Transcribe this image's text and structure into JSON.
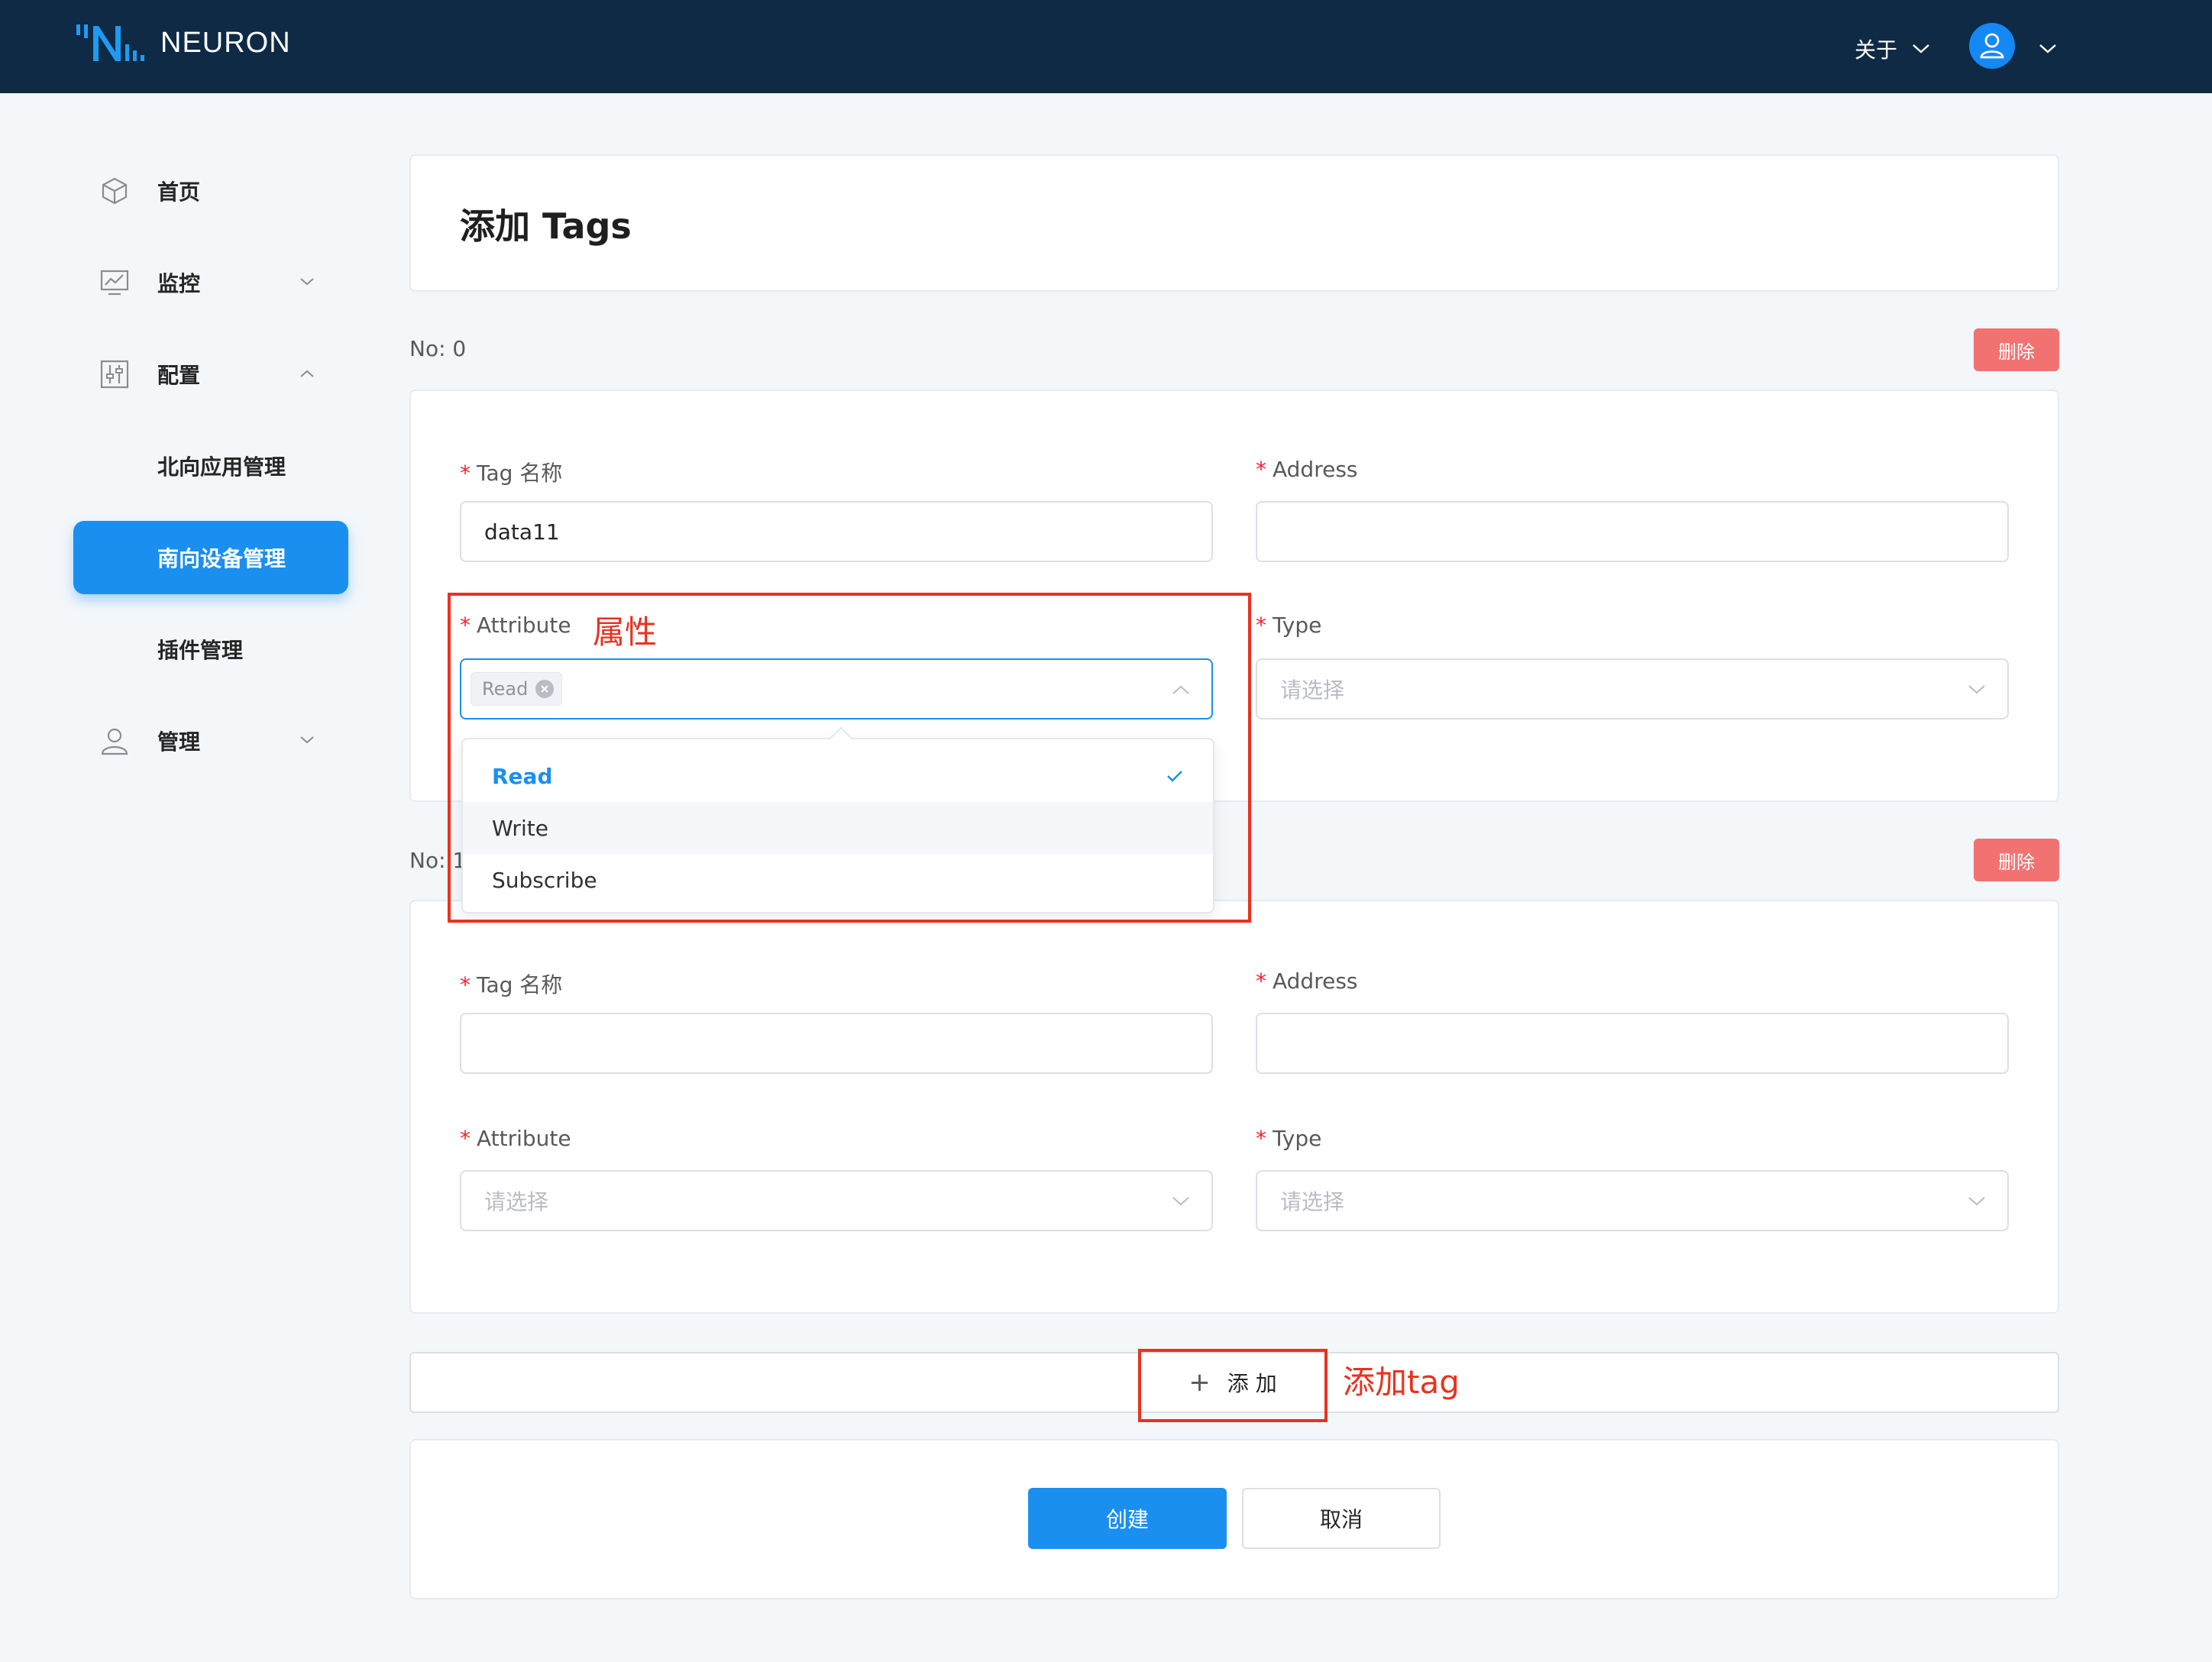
{
  "header": {
    "brand": "NEURON",
    "about_label": "关于",
    "colors": {
      "bg": "#0e2a45",
      "accent": "#1488f5"
    }
  },
  "sidebar": {
    "items": [
      {
        "label": "首页",
        "icon": "cube-icon"
      },
      {
        "label": "监控",
        "icon": "monitor-chart-icon",
        "expanded": false
      },
      {
        "label": "配置",
        "icon": "settings-sliders-icon",
        "expanded": true
      },
      {
        "label": "北向应用管理"
      },
      {
        "label": "南向设备管理",
        "active": true
      },
      {
        "label": "插件管理"
      },
      {
        "label": "管理",
        "icon": "user-icon",
        "expanded": false
      }
    ]
  },
  "page": {
    "title": "添加 Tags"
  },
  "tags": [
    {
      "no_label": "No: 0",
      "delete_label": "删除",
      "tag_name_label": "Tag 名称",
      "tag_name_value": "data11",
      "address_label": "Address",
      "address_value": "",
      "attribute_label": "Attribute",
      "attribute_selected": [
        "Read"
      ],
      "type_label": "Type",
      "type_placeholder": "请选择"
    },
    {
      "no_label": "No: 1",
      "delete_label": "删除",
      "tag_name_label": "Tag 名称",
      "tag_name_value": "",
      "address_label": "Address",
      "address_value": "",
      "attribute_label": "Attribute",
      "attribute_placeholder": "请选择",
      "type_label": "Type",
      "type_placeholder": "请选择"
    }
  ],
  "attribute_dropdown": {
    "options": [
      "Read",
      "Write",
      "Subscribe"
    ],
    "selected": "Read",
    "hovered": "Write"
  },
  "required_mark": "*",
  "annotations": {
    "attribute_note": "属性",
    "add_note": "添加tag",
    "color": "#e8321f"
  },
  "actions": {
    "add_label": "添 加",
    "add_icon": "plus-icon",
    "create_label": "创建",
    "cancel_label": "取消"
  }
}
